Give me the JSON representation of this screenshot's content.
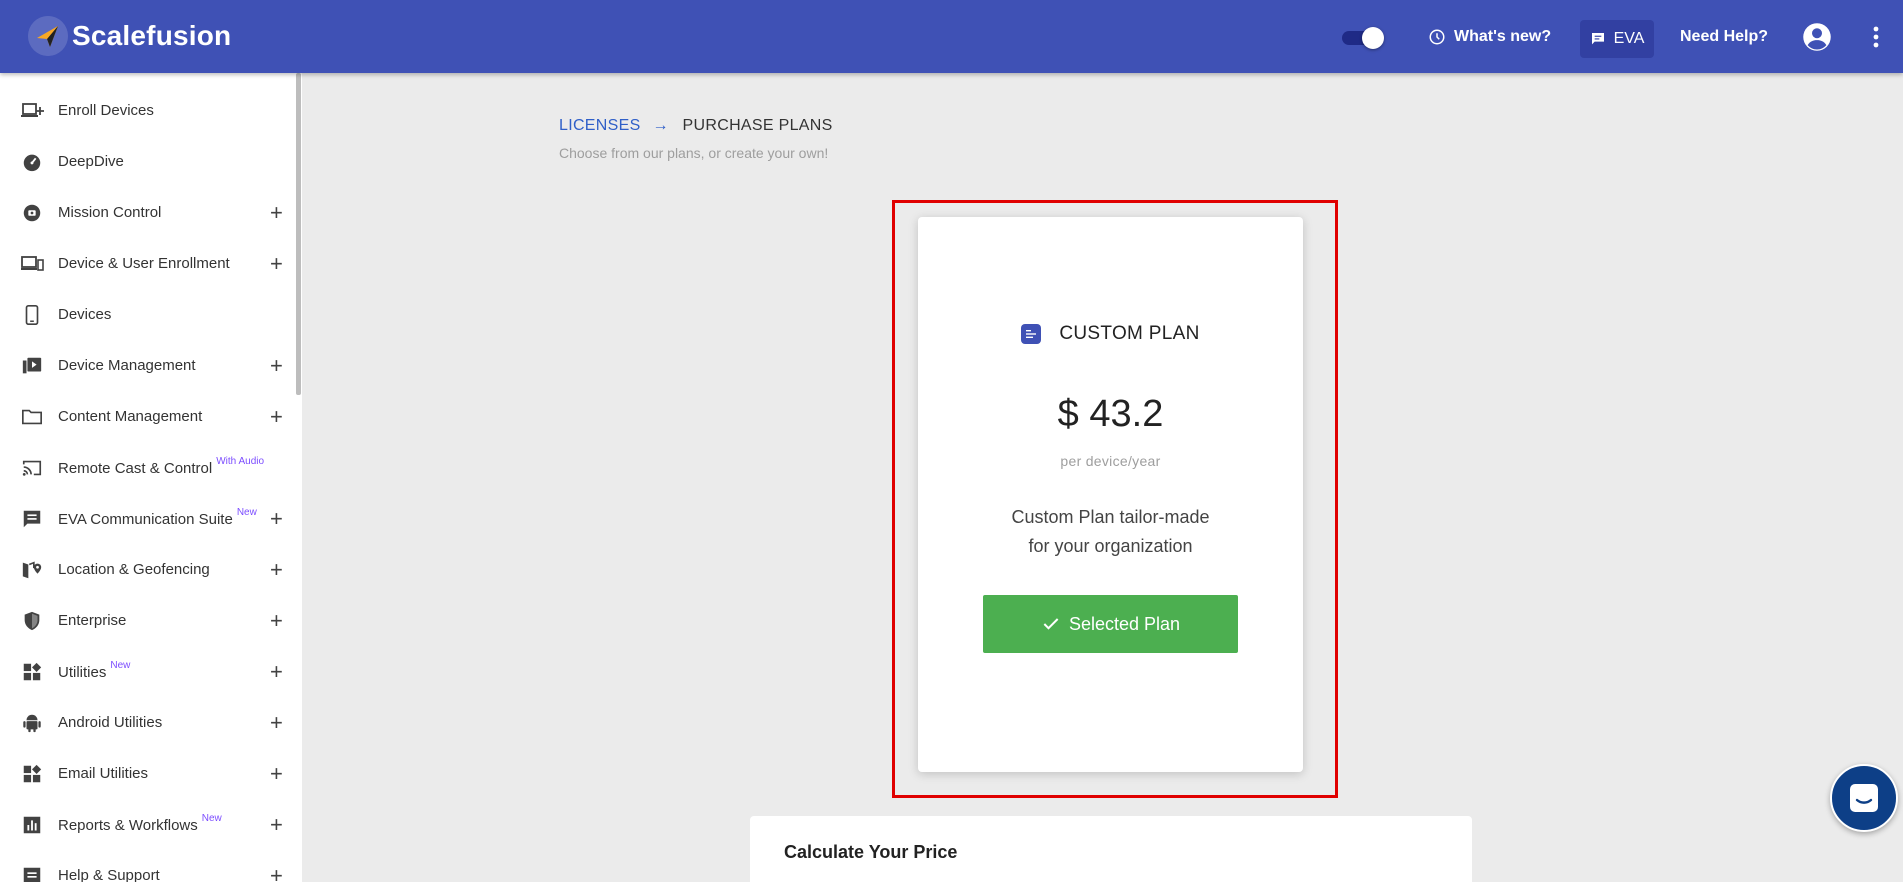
{
  "header": {
    "brand": "Scalefusion",
    "whats_new": "What's new?",
    "eva": "EVA",
    "need_help": "Need Help?"
  },
  "sidebar": {
    "items": [
      {
        "label": "Enroll Devices",
        "icon": "enroll-devices-icon",
        "expandable": false,
        "badge": ""
      },
      {
        "label": "DeepDive",
        "icon": "speedometer-icon",
        "expandable": false,
        "badge": ""
      },
      {
        "label": "Mission Control",
        "icon": "mission-control-icon",
        "expandable": true,
        "badge": ""
      },
      {
        "label": "Device & User Enrollment",
        "icon": "devices-icon",
        "expandable": true,
        "badge": ""
      },
      {
        "label": "Devices",
        "icon": "phone-icon",
        "expandable": false,
        "badge": ""
      },
      {
        "label": "Device Management",
        "icon": "device-management-icon",
        "expandable": true,
        "badge": ""
      },
      {
        "label": "Content Management",
        "icon": "folder-icon",
        "expandable": true,
        "badge": ""
      },
      {
        "label": "Remote Cast & Control",
        "icon": "cast-icon",
        "expandable": false,
        "badge": "With Audio"
      },
      {
        "label": "EVA Communication Suite",
        "icon": "chat-icon",
        "expandable": true,
        "badge": "New"
      },
      {
        "label": "Location & Geofencing",
        "icon": "map-pin-icon",
        "expandable": true,
        "badge": ""
      },
      {
        "label": "Enterprise",
        "icon": "shield-icon",
        "expandable": true,
        "badge": ""
      },
      {
        "label": "Utilities",
        "icon": "widgets-icon",
        "expandable": true,
        "badge": "New"
      },
      {
        "label": "Android Utilities",
        "icon": "android-icon",
        "expandable": true,
        "badge": ""
      },
      {
        "label": "Email Utilities",
        "icon": "widgets-icon",
        "expandable": true,
        "badge": ""
      },
      {
        "label": "Reports & Workflows",
        "icon": "bar-chart-icon",
        "expandable": true,
        "badge": "New"
      },
      {
        "label": "Help & Support",
        "icon": "help-icon",
        "expandable": true,
        "badge": ""
      }
    ]
  },
  "main": {
    "breadcrumb": {
      "parent": "LICENSES",
      "arrow": "→",
      "current": "PURCHASE PLANS"
    },
    "subtitle": "Choose from our plans, or create your own!",
    "plan": {
      "name": "CUSTOM PLAN",
      "price": "$ 43.2",
      "per": "per device/year",
      "desc_line1": "Custom Plan tailor-made",
      "desc_line2": "for your organization",
      "button": "Selected Plan"
    },
    "calculator": {
      "title": "Calculate Your Price"
    }
  },
  "colors": {
    "header": "#3f51b5",
    "selected_button": "#4caf50",
    "highlight": "#e00000",
    "chat": "#0d3f87"
  }
}
